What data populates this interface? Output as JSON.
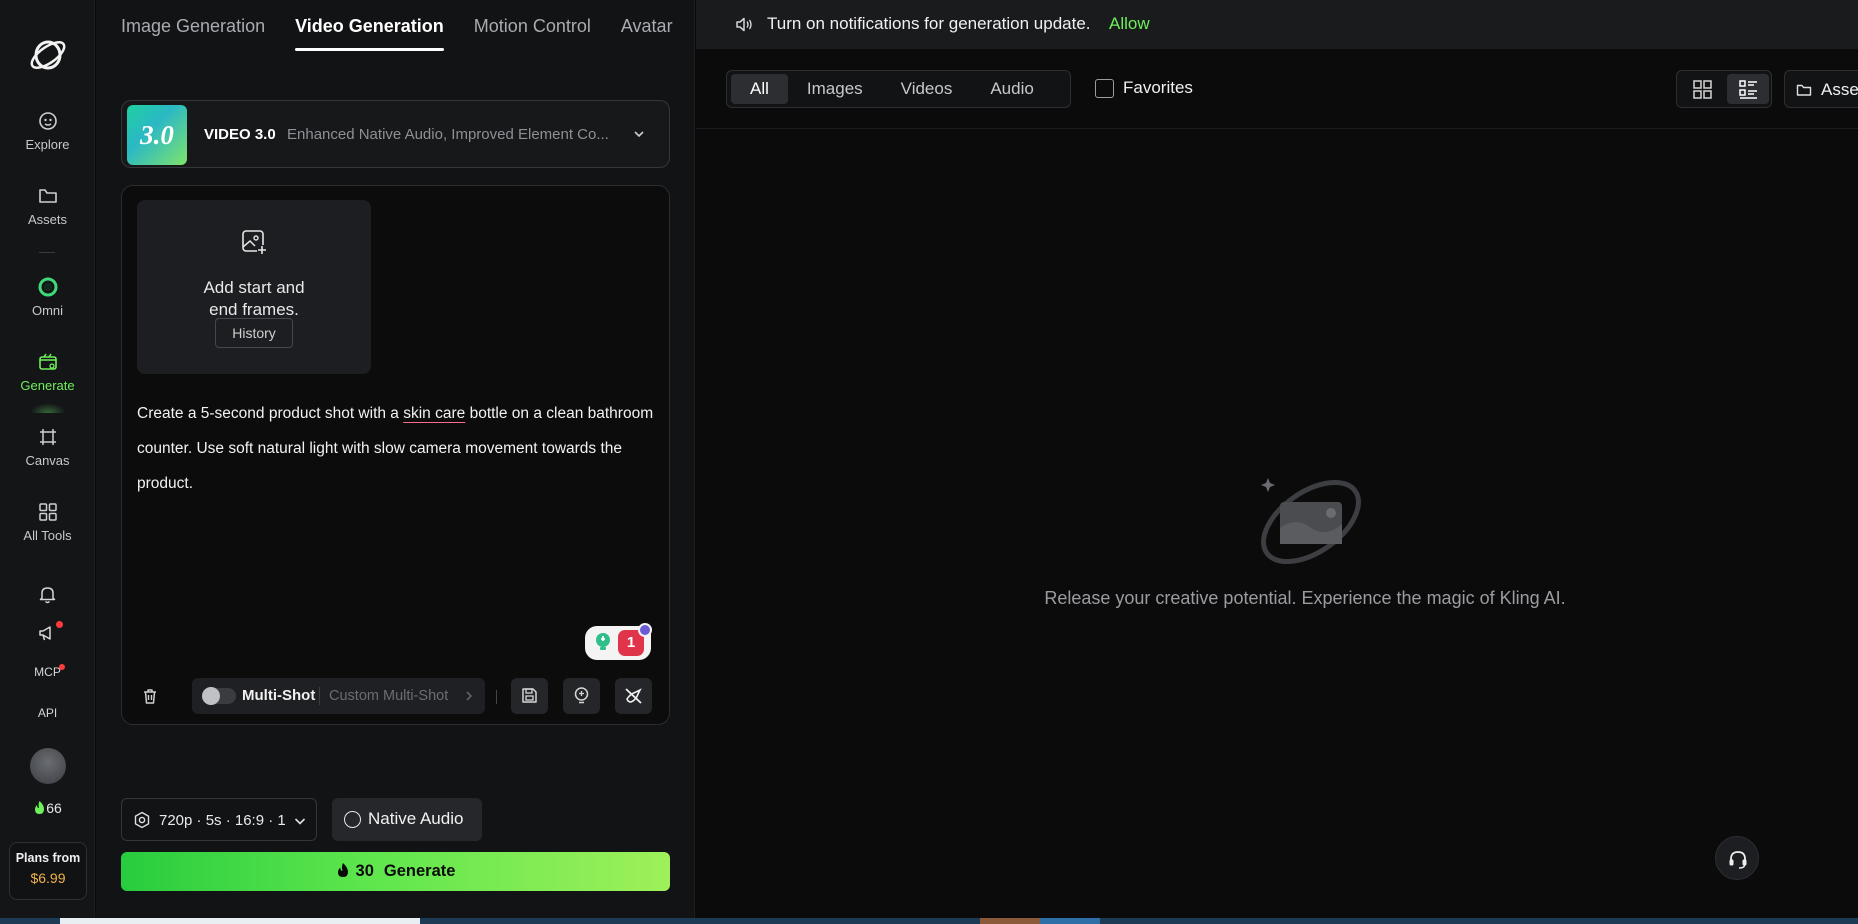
{
  "rail": {
    "items": [
      {
        "label": "Explore",
        "icon": "explore-icon"
      },
      {
        "label": "Assets",
        "icon": "folder-icon"
      },
      {
        "label": "Omni",
        "icon": "omni-icon"
      },
      {
        "label": "Generate",
        "icon": "generate-icon",
        "active": true
      },
      {
        "label": "Canvas",
        "icon": "canvas-icon"
      },
      {
        "label": "All Tools",
        "icon": "grid-icon"
      }
    ],
    "mcp_label": "MCP",
    "api_label": "API",
    "credits": "66",
    "plans_label": "Plans from",
    "plans_price": "$6.99"
  },
  "panel": {
    "tabs": [
      {
        "label": "Image Generation"
      },
      {
        "label": "Video Generation",
        "active": true
      },
      {
        "label": "Motion Control"
      },
      {
        "label": "Avatar"
      }
    ],
    "model": {
      "badge": "3.0",
      "name": "VIDEO 3.0",
      "description": "Enhanced Native Audio, Improved Element Co..."
    },
    "frames": {
      "text_line1": "Add start and",
      "text_line2": "end frames.",
      "history_label": "History"
    },
    "prompt": {
      "before": "Create a 5-second product shot with a ",
      "underlined": "skin care",
      "after": " bottle on a clean bathroom counter. Use soft natural light with slow camera movement towards the product."
    },
    "helper_badge": "1",
    "multishot_label": "Multi-Shot",
    "custom_multishot_label": "Custom Multi-Shot",
    "settings_summary": "720p · 5s · 16:9 · 1",
    "native_audio_label": "Native Audio",
    "generate_cost": "30",
    "generate_label": "Generate",
    "accent_color": "#6ef05a"
  },
  "right": {
    "notification": {
      "text": "Turn on notifications for generation update.",
      "action": "Allow"
    },
    "filters": [
      {
        "label": "All",
        "active": true
      },
      {
        "label": "Images"
      },
      {
        "label": "Videos"
      },
      {
        "label": "Audio"
      }
    ],
    "favorites_label": "Favorites",
    "assets_label": "Assets",
    "empty_text": "Release your creative potential. Experience the magic of Kling AI."
  }
}
